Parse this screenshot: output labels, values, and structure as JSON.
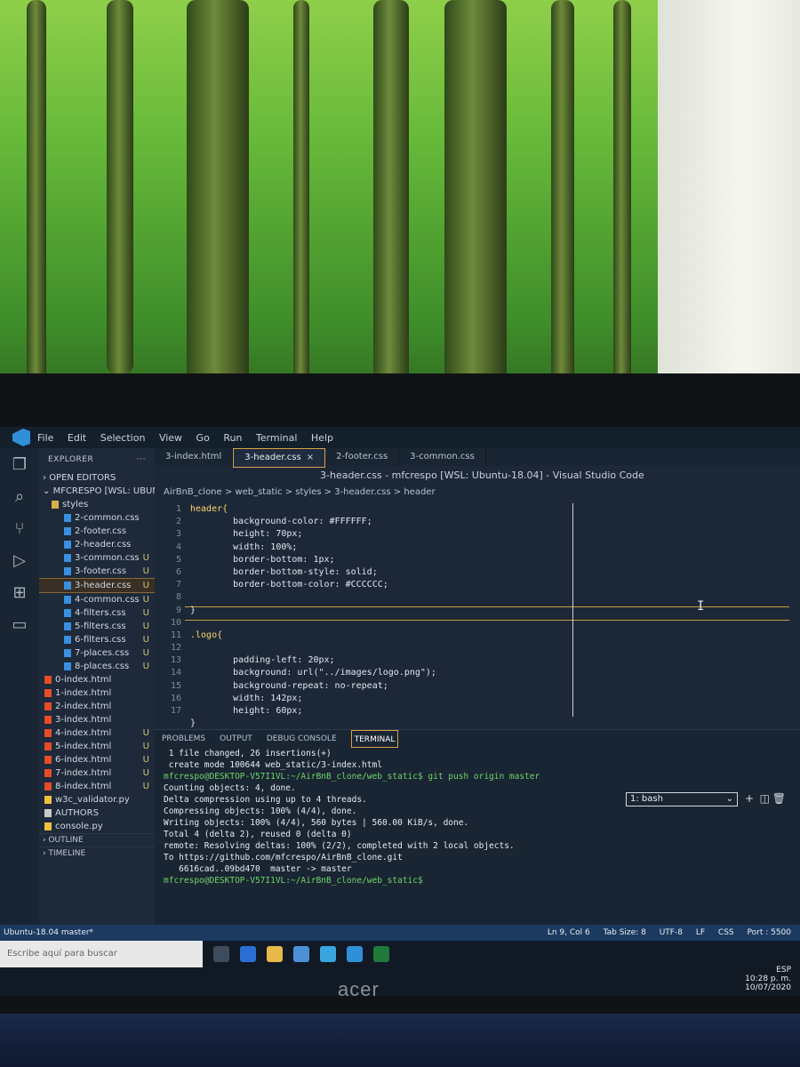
{
  "window": {
    "title": "3-header.css - mfcrespo [WSL: Ubuntu-18.04] - Visual Studio Code"
  },
  "menu": [
    "File",
    "Edit",
    "Selection",
    "View",
    "Go",
    "Run",
    "Terminal",
    "Help"
  ],
  "sidebar": {
    "header": "EXPLORER",
    "more": "···",
    "open_editors": "OPEN EDITORS",
    "workspace": "MFCRESPO [WSL: UBUNTU-18.04]",
    "items": [
      {
        "label": "styles",
        "type": "folder",
        "u": ""
      },
      {
        "label": "2-common.css",
        "type": "css",
        "u": ""
      },
      {
        "label": "2-footer.css",
        "type": "css",
        "u": ""
      },
      {
        "label": "2-header.css",
        "type": "css",
        "u": ""
      },
      {
        "label": "3-common.css",
        "type": "css",
        "u": "U"
      },
      {
        "label": "3-footer.css",
        "type": "css",
        "u": "U"
      },
      {
        "label": "3-header.css",
        "type": "css",
        "u": "U"
      },
      {
        "label": "4-common.css",
        "type": "css",
        "u": "U"
      },
      {
        "label": "4-filters.css",
        "type": "css",
        "u": "U"
      },
      {
        "label": "5-filters.css",
        "type": "css",
        "u": "U"
      },
      {
        "label": "6-filters.css",
        "type": "css",
        "u": "U"
      },
      {
        "label": "7-places.css",
        "type": "css",
        "u": "U"
      },
      {
        "label": "8-places.css",
        "type": "css",
        "u": "U"
      },
      {
        "label": "0-index.html",
        "type": "html",
        "u": ""
      },
      {
        "label": "1-index.html",
        "type": "html",
        "u": ""
      },
      {
        "label": "2-index.html",
        "type": "html",
        "u": ""
      },
      {
        "label": "3-index.html",
        "type": "html",
        "u": ""
      },
      {
        "label": "4-index.html",
        "type": "html",
        "u": "U"
      },
      {
        "label": "5-index.html",
        "type": "html",
        "u": "U"
      },
      {
        "label": "6-index.html",
        "type": "html",
        "u": "U"
      },
      {
        "label": "7-index.html",
        "type": "html",
        "u": "U"
      },
      {
        "label": "8-index.html",
        "type": "html",
        "u": "U"
      },
      {
        "label": "w3c_validator.py",
        "type": "py",
        "u": ""
      },
      {
        "label": "AUTHORS",
        "type": "txt",
        "u": ""
      },
      {
        "label": "console.py",
        "type": "py",
        "u": ""
      }
    ],
    "outline": "OUTLINE",
    "timeline": "TIMELINE"
  },
  "tabs": [
    {
      "label": "3-index.html",
      "active": false
    },
    {
      "label": "3-header.css",
      "active": true
    },
    {
      "label": "2-footer.css",
      "active": false
    },
    {
      "label": "3-common.css",
      "active": false
    }
  ],
  "tab_close": "×",
  "breadcrumbs": "AirBnB_clone > web_static > styles > 3-header.css > header",
  "editor": {
    "line_numbers": [
      "1",
      "2",
      "3",
      "4",
      "5",
      "6",
      "7",
      "8",
      "9",
      "10",
      "11",
      "12",
      "13",
      "14",
      "15",
      "16",
      "17"
    ],
    "lines": [
      "header{",
      "        background-color: #FFFFFF;",
      "        height: 70px;",
      "        width: 100%;",
      "        border-bottom: 1px;",
      "        border-bottom-style: solid;",
      "        border-bottom-color: #CCCCCC;",
      "",
      "}",
      "",
      ".logo{",
      "",
      "        padding-left: 20px;",
      "        background: url(\"../images/logo.png\");",
      "        background-repeat: no-repeat;",
      "        width: 142px;",
      "        height: 60px;"
    ],
    "last_line": "}"
  },
  "panel": {
    "tabs": [
      "PROBLEMS",
      "OUTPUT",
      "DEBUG CONSOLE",
      "TERMINAL"
    ],
    "terminal_select": "1: bash",
    "lines": [
      " 1 file changed, 26 insertions(+)",
      " create mode 100644 web_static/3-index.html",
      "mfcrespo@DESKTOP-V57I1VL:~/AirBnB_clone/web_static$ git push origin master",
      "Counting objects: 4, done.",
      "Delta compression using up to 4 threads.",
      "Compressing objects: 100% (4/4), done.",
      "Writing objects: 100% (4/4), 560 bytes | 560.00 KiB/s, done.",
      "Total 4 (delta 2), reused 0 (delta 0)",
      "remote: Resolving deltas: 100% (2/2), completed with 2 local objects.",
      "To https://github.com/mfcrespo/AirBnB_clone.git",
      "   6616cad..09bd470  master -> master",
      "mfcrespo@DESKTOP-V57I1VL:~/AirBnB_clone/web_static$ "
    ]
  },
  "status": {
    "left": "Ubuntu-18.04   master*",
    "position": "Ln 9, Col 6",
    "tab_size": "Tab Size: 8",
    "encoding": "UTF-8",
    "eol": "LF",
    "language": "CSS",
    "port": "Port : 5500"
  },
  "taskbar": {
    "search": "Escribe aquí para buscar",
    "lang": "ESP",
    "time": "10:28 p. m.",
    "date": "10/07/2020"
  },
  "laptop": {
    "brand": "acer"
  },
  "colors": {
    "accent_tab": "#d8a24a",
    "statusbar": "#1c3a60",
    "editor_bg": "#1c2838",
    "sidebar_bg": "#1e2a3a",
    "selector": "#ffd46b",
    "prompt_user": "#6fd56a",
    "prompt_path": "#6aa7ff"
  }
}
